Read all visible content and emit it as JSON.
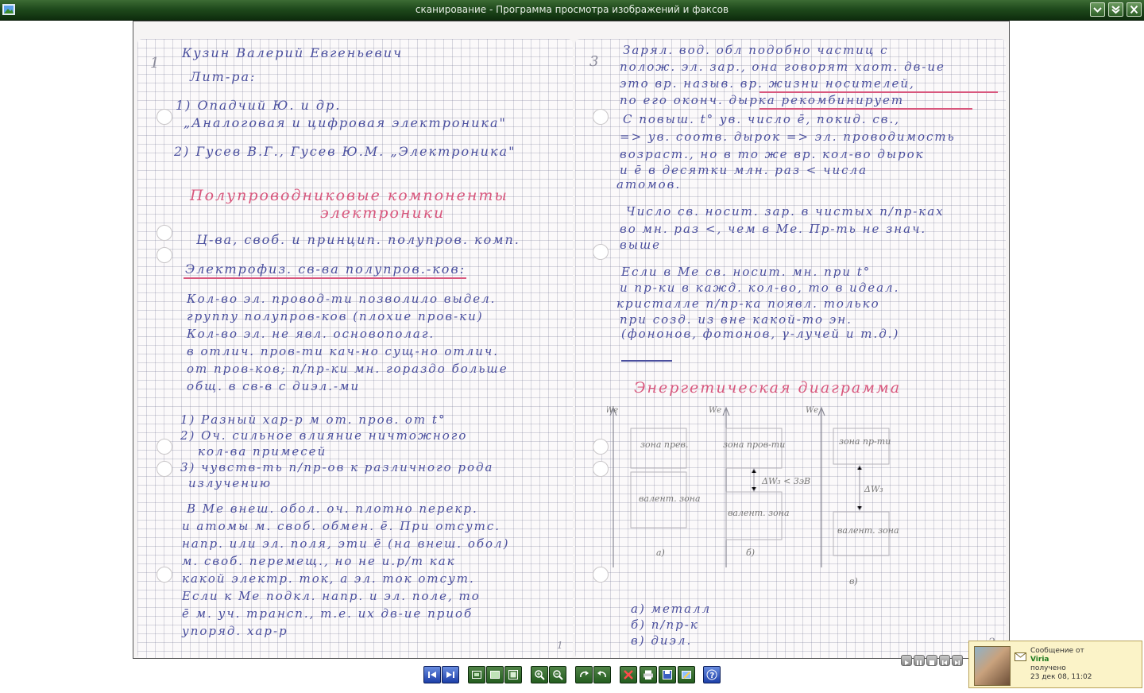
{
  "window": {
    "title": "сканирование - Программа просмотра изображений и факсов",
    "app_icon": "image-viewer-icon",
    "controls": [
      "minimize-icon",
      "restore-icon",
      "close-icon"
    ]
  },
  "scan": {
    "left_page": {
      "page_number": "1",
      "lines": [
        "Кузин Валерий Евгеньевич",
        "Лит-ра:",
        "1) Опадчий Ю. и др.",
        "„Аналоговая и цифровая электроника\"",
        "2) Гусев В.Г., Гусев Ю.М. „Электроника\""
      ],
      "heading_1": "Полупроводниковые компоненты",
      "heading_2": "электроники",
      "lines2": [
        "Ц-ва, своб. и принцип. полупров. комп.",
        "Электрофиз. св-ва полупров.-ков:"
      ],
      "paragraph1": [
        "Кол-во эл. провод-ти позволило выдел.",
        "группу полупров-ков (плохие пров-ки)",
        "Кол-во эл. не явл. основополаг.",
        "в отлич. пров-ти кач-но сущ-но отлич.",
        "от пров-ков; п/пр-ки мн. гораздо больше",
        "общ. в св-в с диэл.-ми"
      ],
      "list": [
        "1) Разный хар-р м от. пров. от t°",
        "2) Оч. сильное влияние ничтожного",
        "кол-ва примесей",
        "3) чувств-ть п/пр-ов к различного рода",
        "излучению"
      ],
      "paragraph2": [
        "В Ме внеш. обол. оч. плотно перекр.",
        "и атомы м. своб. обмен. ē. При отсутс.",
        "напр. или эл. поля, эти ē (на внеш. обол)",
        "м. своб. перемещ., но не и.р/т как",
        "какой электр. ток, а эл. ток отсут.",
        "Если к Ме подкл. напр. и эл. поле, то",
        "ē м. уч. трансп., т.е. их дв-ие приоб",
        "упоряд. хар-р"
      ],
      "footer_num": "1"
    },
    "right_page": {
      "page_number": "3",
      "lines": [
        "Зарял. вод. обл подобно частиц с",
        "полож. эл. зар., она говорят хаот. дв-ие",
        "это вр. назыв. вр. жизни носителей,",
        "по его оконч. дырка рекомбинирует",
        "С повыш. t° ув. число ē, покид. св.,",
        "=> ув. соотв. дырок => эл. проводимость",
        "возраст., но в то же вр. кол-во дырок",
        "и ē в десятки млн. раз < числа",
        "атомов."
      ],
      "paragraph2": [
        "Число св. носит. зар. в чистых п/пр-ках",
        "во мн. раз <, чем в Ме. Пр-ть не знач.",
        "выше"
      ],
      "paragraph3": [
        "Если в Ме св. носит. мн. при t°",
        "и пр-ки в кажд. кол-во, то в идеал.",
        "кристалле п/пр-ка появл. только",
        "при созд. из вне какой-то эн.",
        "(фононов, фотонов, γ-лучей и т.д.)"
      ],
      "heading": "Энергетическая диаграмма",
      "diagram": {
        "axis_labels": [
          "Wе",
          "Wе",
          "Wе"
        ],
        "band_top": [
          "зона прев.",
          "зона пров-ти",
          "зона пр-ти"
        ],
        "band_bottom": [
          "валент. зона",
          "валент. зона",
          "валент. зона"
        ],
        "gap_labels": [
          "ΔW₃ < 3эВ",
          "ΔW₃"
        ],
        "sub_labels": [
          "а)",
          "б)",
          "в)"
        ]
      },
      "legend": [
        "а) металл",
        "б) п/пр-к",
        "в) диэл."
      ],
      "footer_num": "2"
    }
  },
  "toolbar": {
    "buttons": [
      "previous-image-icon",
      "next-image-icon",
      "best-fit-icon",
      "actual-size-icon",
      "slideshow-icon",
      "zoom-in-icon",
      "zoom-out-icon",
      "rotate-clockwise-icon",
      "rotate-counterclockwise-icon",
      "delete-icon",
      "print-icon",
      "save-icon",
      "open-editor-icon",
      "help-icon"
    ]
  },
  "notification": {
    "title": "Сообщение от",
    "sender": "Viria",
    "status": "получено",
    "datetime": "23 дек 08, 11:02"
  },
  "colors": {
    "titlebar": "#1f4a1c",
    "ink": "#4a4f9e",
    "red_ink": "#d8577d",
    "notif_bg": "#fbf3c8"
  }
}
